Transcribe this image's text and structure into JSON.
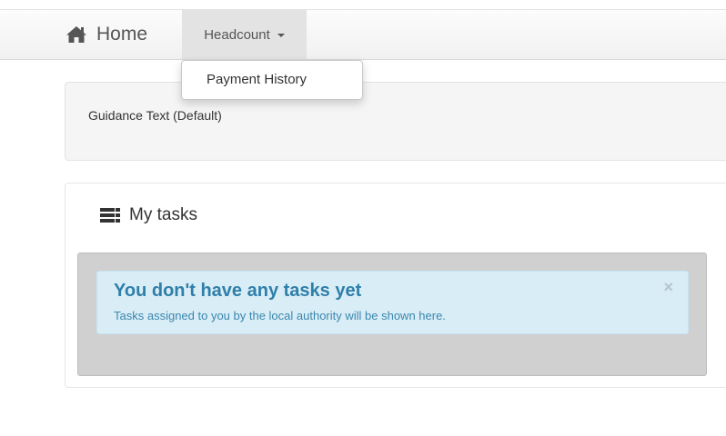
{
  "navbar": {
    "home": {
      "label": "Home",
      "icon": "home-icon"
    },
    "headcount": {
      "label": "Headcount",
      "icon": "caret-down-icon"
    }
  },
  "dropdown": {
    "items": [
      {
        "label": "Payment History"
      }
    ]
  },
  "guidance": {
    "text": "Guidance Text (Default)"
  },
  "tasks": {
    "title": "My tasks",
    "icon": "tasks-list-icon",
    "alert": {
      "title": "You don't have any tasks yet",
      "body": "Tasks assigned to you by the local authority will be shown here.",
      "close": "×"
    }
  },
  "colors": {
    "alert_background": "#d9edf7",
    "alert_title": "#2f7fa9",
    "alert_text": "#3a87ad",
    "well_background": "#d0d0d0",
    "active_nav": "#e3e3e3"
  }
}
